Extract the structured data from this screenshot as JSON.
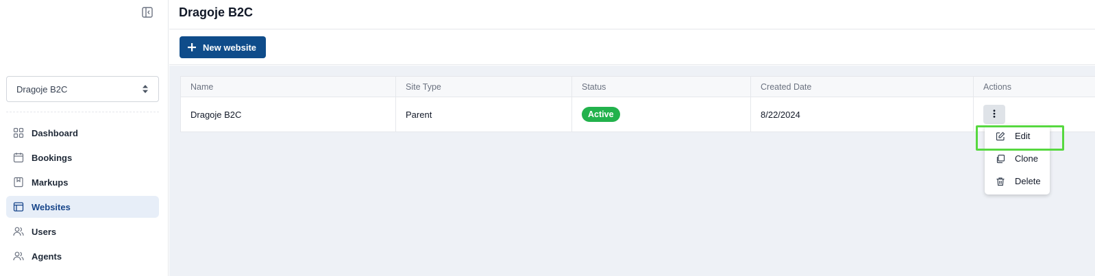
{
  "sidebar": {
    "site_selector": {
      "value": "Dragoje B2C"
    },
    "items": [
      {
        "label": "Dashboard",
        "icon": "grid-icon"
      },
      {
        "label": "Bookings",
        "icon": "calendar-icon"
      },
      {
        "label": "Markups",
        "icon": "tag-icon"
      },
      {
        "label": "Websites",
        "icon": "browser-icon",
        "active": true
      },
      {
        "label": "Users",
        "icon": "users-icon"
      },
      {
        "label": "Agents",
        "icon": "users-icon"
      }
    ]
  },
  "header": {
    "title": "Dragoje B2C"
  },
  "toolbar": {
    "new_label": "New website"
  },
  "table": {
    "columns": [
      "Name",
      "Site Type",
      "Status",
      "Created Date",
      "Actions"
    ],
    "rows": [
      {
        "name": "Dragoje B2C",
        "site_type": "Parent",
        "status": "Active",
        "created": "8/22/2024"
      }
    ]
  },
  "actions_menu": {
    "items": [
      {
        "label": "Edit",
        "icon": "edit-icon"
      },
      {
        "label": "Clone",
        "icon": "copy-icon"
      },
      {
        "label": "Delete",
        "icon": "trash-icon"
      }
    ]
  },
  "colors": {
    "primary": "#0f4c8a",
    "active_badge": "#22b24c",
    "highlight": "#56d83f",
    "active_nav_bg": "#e7eef8"
  }
}
